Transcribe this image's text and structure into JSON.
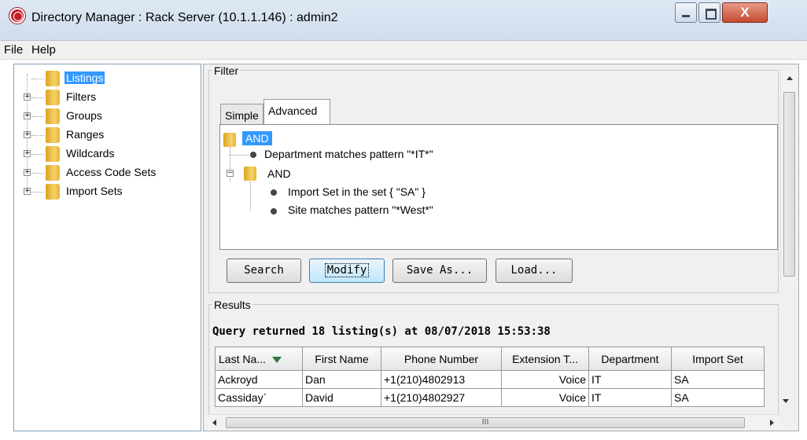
{
  "window": {
    "title": "Directory Manager : Rack Server (10.1.1.146) : admin2",
    "close_glyph": "X"
  },
  "menu": {
    "file": "File",
    "help": "Help"
  },
  "tree": {
    "items": [
      {
        "label": "Listings",
        "expanded": false,
        "selected": true
      },
      {
        "label": "Filters",
        "expanded": false,
        "selected": false
      },
      {
        "label": "Groups",
        "expanded": false,
        "selected": false
      },
      {
        "label": "Ranges",
        "expanded": false,
        "selected": false
      },
      {
        "label": "Wildcards",
        "expanded": false,
        "selected": false
      },
      {
        "label": "Access Code Sets",
        "expanded": false,
        "selected": false
      },
      {
        "label": "Import Sets",
        "expanded": false,
        "selected": false
      }
    ],
    "expander_glyph": "+",
    "collapse_glyph": "−"
  },
  "filter": {
    "title": "Filter",
    "tabs": {
      "simple": "Simple",
      "advanced": "Advanced"
    },
    "conditions": {
      "root": "AND",
      "c1": "Department matches pattern \"*IT*\"",
      "sub": "AND",
      "c2": "Import Set in the set { \"SA\" }",
      "c3": "Site matches pattern \"*West*\""
    },
    "buttons": {
      "search": "Search",
      "modify": "Modify",
      "save_as": "Save As...",
      "load": "Load..."
    }
  },
  "results": {
    "title": "Results",
    "summary": "Query returned 18 listing(s) at 08/07/2018 15:53:38",
    "columns": [
      "Last Na...",
      "First Name",
      "Phone Number",
      "Extension T...",
      "Department",
      "Import Set"
    ],
    "rows": [
      [
        "Ackroyd",
        "Dan",
        "+1(210)4802913",
        "Voice",
        "IT",
        "SA"
      ],
      [
        "Cassiday`",
        "David",
        "+1(210)4802927",
        "Voice",
        "IT",
        "SA"
      ]
    ]
  },
  "scrollbar": {
    "h_thumb_grip": "III"
  },
  "colors": {
    "selection": "#3399ff",
    "close_button": "#c54a32",
    "sort_arrow": "#2d7a3a"
  },
  "icons": [
    "app-logo-icon",
    "folder-icon",
    "sort-desc-icon"
  ]
}
